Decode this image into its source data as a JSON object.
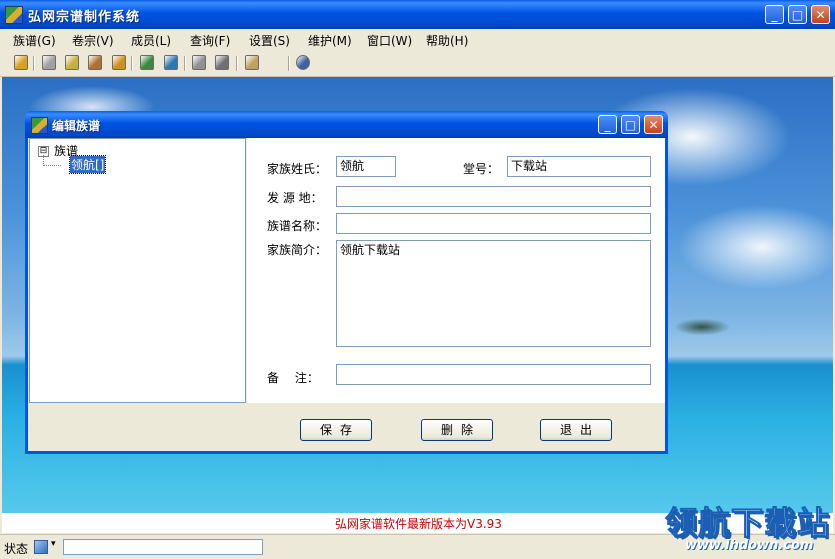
{
  "app": {
    "title": "弘网宗谱制作系统"
  },
  "window_buttons": {
    "minimize": "_",
    "maximize": "□",
    "close": "✕"
  },
  "menu": [
    {
      "label": "族谱(G)"
    },
    {
      "label": "卷宗(V)"
    },
    {
      "label": "成员(L)"
    },
    {
      "label": "查询(F)"
    },
    {
      "label": "设置(S)"
    },
    {
      "label": "维护(M)"
    },
    {
      "label": "窗口(W)"
    },
    {
      "label": "帮助(H)"
    }
  ],
  "toolbar": {
    "icons": [
      "open-icon",
      "new-icon",
      "book-icon",
      "edit-icon",
      "member-icon",
      "tree-icon",
      "user-icon",
      "print-icon",
      "export-icon",
      "image-icon",
      "web-icon"
    ],
    "colors": [
      "#d8a020",
      "#a0a0a0",
      "#c8b040",
      "#b07030",
      "#d09020",
      "#3a8a3a",
      "#2a7ab0",
      "#909090",
      "#707070",
      "#c0a060",
      "#4060a0"
    ]
  },
  "dialog": {
    "title": "编辑族谱",
    "tree": {
      "root": "族谱",
      "expander": "⊟",
      "child": "领航[]"
    },
    "form": {
      "surname_label": "家族姓氏：",
      "surname_value": "领航",
      "hall_label": "堂号：",
      "hall_value": "下载站",
      "origin_label": "发 源 地：",
      "origin_value": "",
      "name_label": "族谱名称：",
      "name_value": "",
      "intro_label": "家族简介：",
      "intro_value": "领航下载站",
      "remark_label": "备　 注：",
      "remark_value": ""
    },
    "buttons": {
      "save": "保存",
      "delete": "删除",
      "exit": "退出"
    }
  },
  "version_text": "弘网家谱软件最新版本为V3.93",
  "status": {
    "label": "状态",
    "arrow": "▾"
  },
  "watermark": {
    "big": "领航下载站",
    "small": "www.lhdown.com"
  },
  "colors": {
    "titlebar": "#0054e3",
    "version_text": "#d40000",
    "selection": "#316ac5"
  }
}
